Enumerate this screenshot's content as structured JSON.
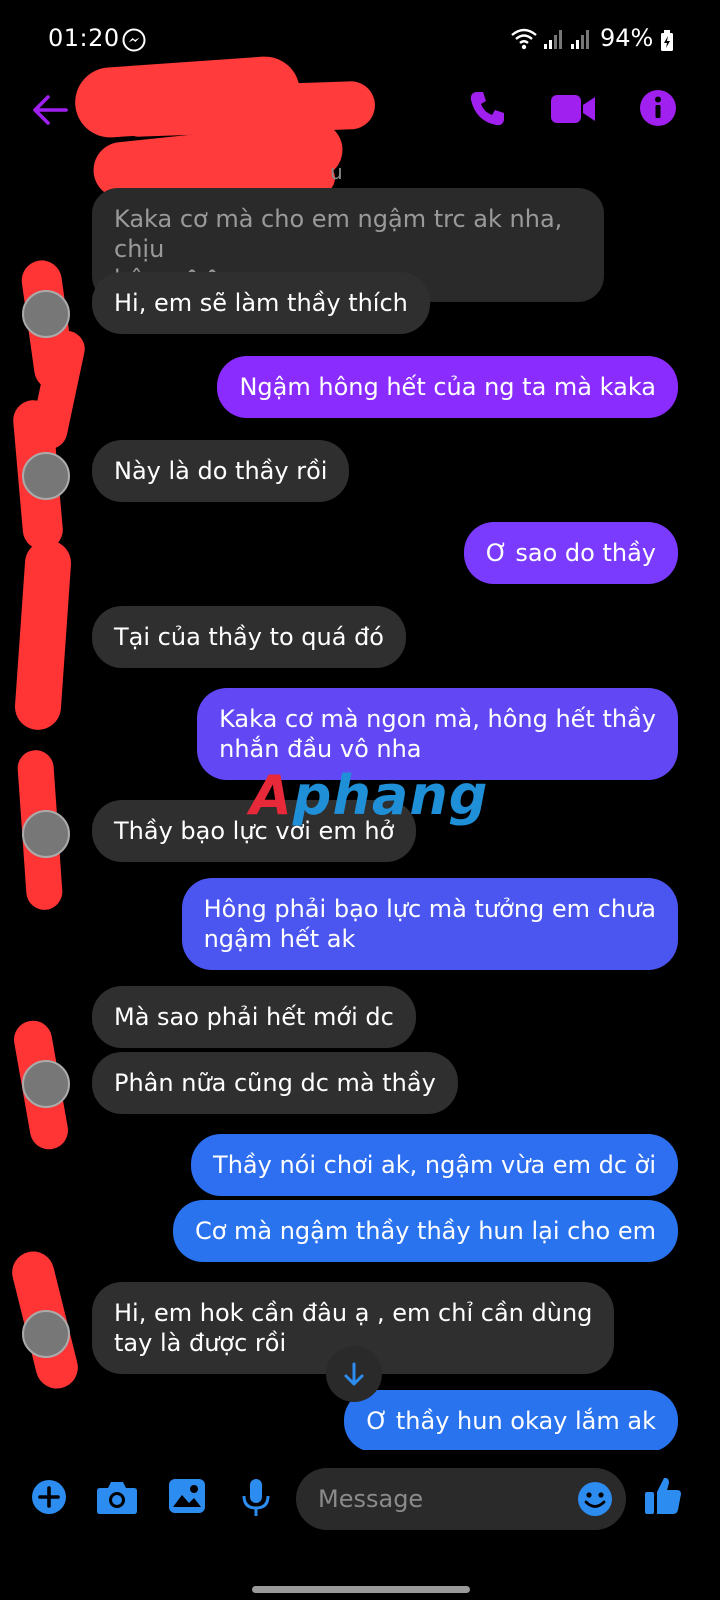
{
  "status_bar": {
    "time": "01:20",
    "battery": "94%"
  },
  "header": {
    "back_icon": "arrow-left-icon",
    "call_icon": "phone-icon",
    "video_icon": "video-camera-icon",
    "info_icon": "info-icon",
    "accent_color": "#a020f0"
  },
  "chat": {
    "reply_preview_label": "u",
    "reply_preview_text": "Kaka cơ mà cho em ngậm trc ak nha, chịu\nhông ^^",
    "messages": [
      {
        "side": "in",
        "text": "Hi, em sẽ làm thầy thích"
      },
      {
        "side": "out",
        "text": "Ngậm hông hết của ng ta mà kaka"
      },
      {
        "side": "in",
        "text": "Này là do thầy rồi"
      },
      {
        "side": "out",
        "text": "Ơ sao do thầy"
      },
      {
        "side": "in",
        "text": "Tại của thầy to quá đó"
      },
      {
        "side": "out",
        "text": "Kaka cơ mà ngon mà, hông hết thầy\nnhắn đầu vô nha"
      },
      {
        "side": "in",
        "text": "Thầy bạo lực với em hở"
      },
      {
        "side": "out",
        "text": "Hông phải bạo lực mà tưởng em chưa\nngậm hết ak"
      },
      {
        "side": "in",
        "text": "Mà sao phải hết mới dc"
      },
      {
        "side": "in",
        "text": "Phân nữa cũng dc mà thầy"
      },
      {
        "side": "out",
        "text": "Thầy nói chơi ak, ngậm vừa em dc ời"
      },
      {
        "side": "out",
        "text": "Cơ mà ngậm thầy thầy hun lại cho em"
      },
      {
        "side": "in",
        "text": "Hi, em hok cần đâu ạ , em chỉ cần dùng\ntay là được rồi"
      },
      {
        "side": "out",
        "text": "Ơ thầy hun okay lắm ak"
      }
    ],
    "watermark_a": "A",
    "watermark_rest": "phang"
  },
  "input_bar": {
    "placeholder": "Message",
    "icons": [
      "plus-icon",
      "camera-icon",
      "gallery-icon",
      "microphone-icon",
      "emoji-icon",
      "thumbs-up-icon"
    ],
    "icon_color": "#2d8cf0"
  }
}
